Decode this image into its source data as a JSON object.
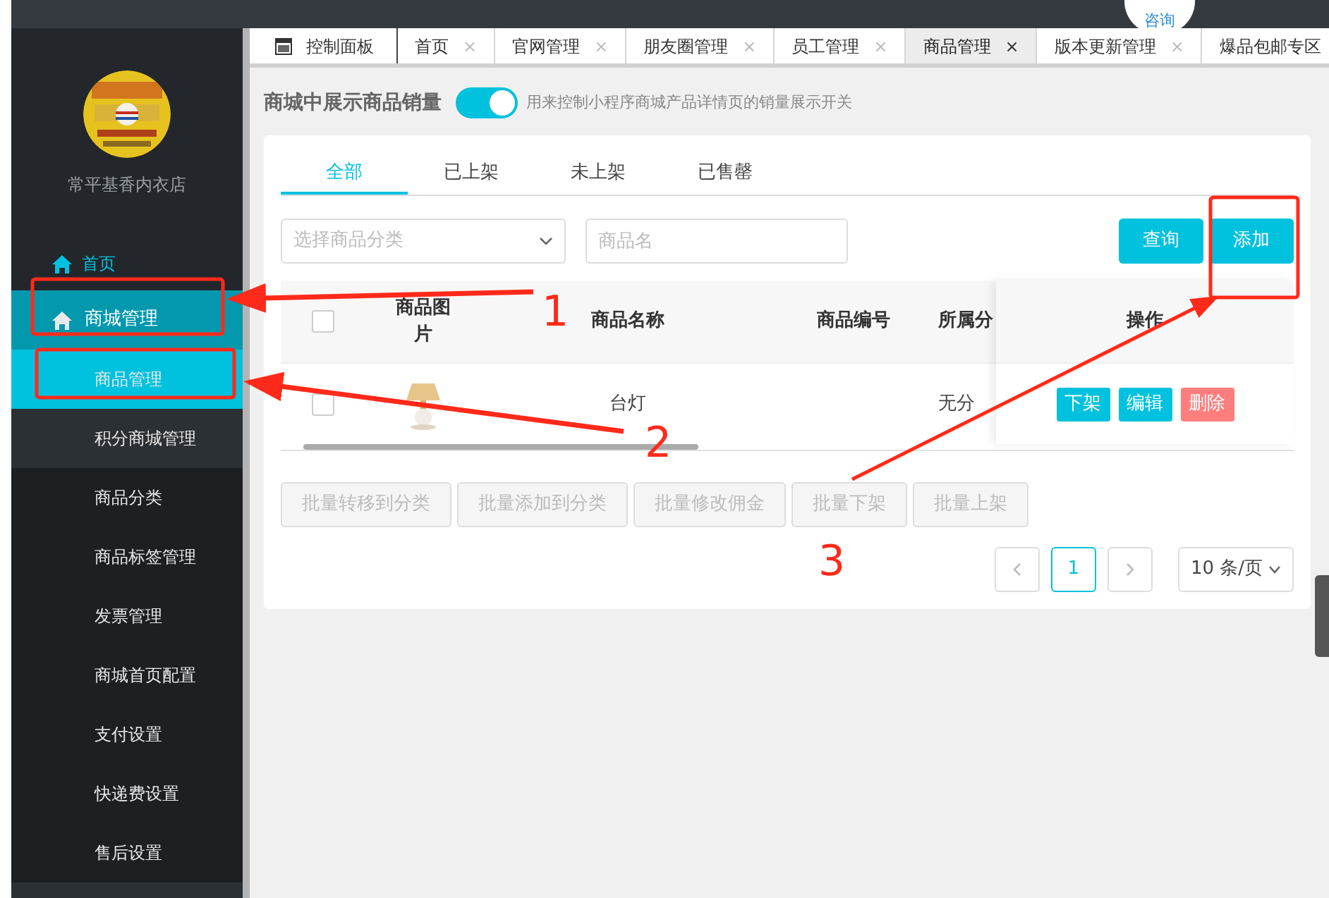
{
  "header": {
    "consult_label": "咨询"
  },
  "sidebar": {
    "store_name": "常平基香内衣店",
    "items": [
      {
        "label": "首页",
        "kind": "link",
        "selected": false
      },
      {
        "label": "商城管理",
        "kind": "group",
        "expanded": true,
        "children": [
          {
            "label": "商品管理",
            "selected": true,
            "hovered": false
          },
          {
            "label": "积分商城管理",
            "selected": false,
            "hovered": true
          },
          {
            "label": "商品分类",
            "selected": false,
            "hovered": false
          },
          {
            "label": "商品标签管理",
            "selected": false,
            "hovered": false
          },
          {
            "label": "发票管理",
            "selected": false,
            "hovered": false
          },
          {
            "label": "商城首页配置",
            "selected": false,
            "hovered": false
          },
          {
            "label": "支付设置",
            "selected": false,
            "hovered": false
          },
          {
            "label": "快递费设置",
            "selected": false,
            "hovered": false
          },
          {
            "label": "售后设置",
            "selected": false,
            "hovered": false
          }
        ]
      }
    ]
  },
  "tabs": [
    {
      "label": "控制面板",
      "kind": "dashboard",
      "selected": false
    },
    {
      "label": "首页",
      "kind": "page",
      "close": "×",
      "selected": false
    },
    {
      "label": "官网管理",
      "kind": "page",
      "close": "×",
      "selected": false
    },
    {
      "label": "朋友圈管理",
      "kind": "page",
      "close": "×",
      "selected": false
    },
    {
      "label": "员工管理",
      "kind": "page",
      "close": "×",
      "selected": false
    },
    {
      "label": "商品管理",
      "kind": "page",
      "close": "×",
      "selected": true
    },
    {
      "label": "版本更新管理",
      "kind": "page",
      "close": "×",
      "selected": false
    },
    {
      "label": "爆品包邮专区",
      "kind": "cut",
      "selected": false
    }
  ],
  "sales_toggle": {
    "label": "商城中展示商品销量",
    "on": true,
    "hint": "用来控制小程序商城产品详情页的销量展示开关"
  },
  "filter_tabs": [
    {
      "label": "全部",
      "selected": true
    },
    {
      "label": "已上架",
      "selected": false
    },
    {
      "label": "未上架",
      "selected": false
    },
    {
      "label": "已售罄",
      "selected": false
    }
  ],
  "filters": {
    "category_placeholder": "选择商品分类",
    "name_placeholder": "商品名",
    "buttons": [
      "查询",
      "添加"
    ]
  },
  "table": {
    "select_all_checked": false,
    "columns": [
      "商品图片",
      "商品名称",
      "商品编号",
      "所属分"
    ],
    "action_column": "操作",
    "rows": [
      {
        "checked": false,
        "name": "台灯",
        "category": "无分",
        "actions": [
          {
            "label": "下架",
            "kind": "primary"
          },
          {
            "label": "编辑",
            "kind": "primary"
          },
          {
            "label": "删除",
            "kind": "danger"
          }
        ]
      }
    ]
  },
  "batch_buttons": [
    {
      "label": "批量转移到分类",
      "disabled": true
    },
    {
      "label": "批量添加到分类",
      "disabled": true
    },
    {
      "label": "批量修改佣金",
      "disabled": true
    },
    {
      "label": "批量下架",
      "disabled": true
    },
    {
      "label": "批量上架",
      "disabled": true
    }
  ],
  "pagination": {
    "pages": [
      {
        "label": "1",
        "selected": true
      }
    ],
    "page_size": "10 条/页"
  },
  "annotations": [
    {
      "label": "1"
    },
    {
      "label": "2"
    },
    {
      "label": "3"
    }
  ]
}
